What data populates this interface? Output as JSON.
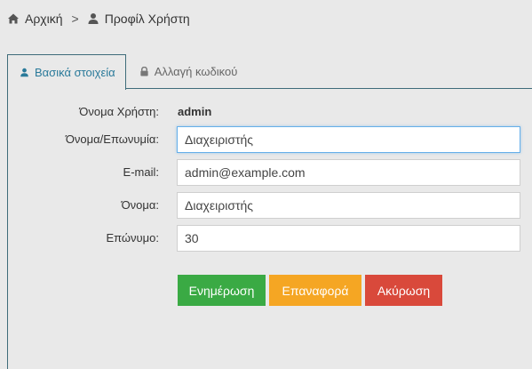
{
  "breadcrumb": {
    "home_icon": "home-icon",
    "home_label": "Αρχική",
    "separator": ">",
    "user_icon": "user-icon",
    "current_label": "Προφίλ Χρήστη"
  },
  "tabs": [
    {
      "label": "Βασικά στοιχεία",
      "icon": "user-icon",
      "active": true
    },
    {
      "label": "Αλλαγή κωδικού",
      "icon": "lock-icon",
      "active": false
    }
  ],
  "form": {
    "username_label": "Όνομα Χρήστη:",
    "username_value": "admin",
    "fullname_label": "Όνομα/Επωνυμία:",
    "fullname_value": "Διαχειριστής",
    "email_label": "E-mail:",
    "email_value": "admin@example.com",
    "firstname_label": "Όνομα:",
    "firstname_value": "Διαχειριστής",
    "lastname_label": "Επώνυμο:",
    "lastname_value": "30"
  },
  "buttons": {
    "update_label": "Ενημέρωση",
    "reset_label": "Επαναφορά",
    "cancel_label": "Ακύρωση"
  },
  "colors": {
    "update": "#3aaa44",
    "reset": "#f5a623",
    "cancel": "#d9493b",
    "tab_active_text": "#2a7a9a"
  }
}
